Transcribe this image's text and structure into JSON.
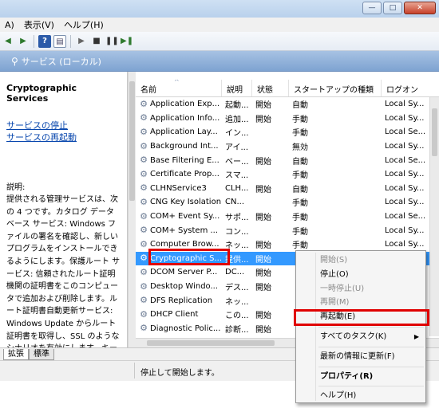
{
  "window": {
    "min": "—",
    "max": "□",
    "close": "✕"
  },
  "menu": {
    "items": [
      "A)",
      "表示(V)",
      "ヘルプ(H)"
    ]
  },
  "toolbar": {
    "icons": [
      "forward-icon",
      "back-icon",
      "help-icon",
      "properties-icon",
      "play-icon",
      "stop-icon",
      "pause-icon",
      "restart-icon"
    ]
  },
  "scope": {
    "title": "サービス (ローカル)",
    "icon": "search-icon"
  },
  "left": {
    "service_name": "Cryptographic Services",
    "link_stop": "サービスの停止",
    "link_restart": "サービスの再起動",
    "desc_label": "説明:",
    "desc_text": "提供される管理サービスは、次の 4 つです。カタログ データベース サービス: Windows ファイルの署名を確認し、新しいプログラムをインストールできるようにします。保護ルート サービス: 信頼されたルート証明機関の証明書をこのコンピュータで追加および削除します。ルート証明書自動更新サービス: Windows Update からルート証明書を取得し、SSL のようなシナリオを有効にします。キー サービス: 証明書用にこのコンピュータを登録します。このサー"
  },
  "columns": {
    "name": "名前",
    "desc": "説明",
    "state": "状態",
    "startup": "スタートアップの種類",
    "logon": "ログオン"
  },
  "services": [
    {
      "name": "Application Exp...",
      "desc": "起動...",
      "state": "開始",
      "startup": "自動",
      "logon": "Local Sy..."
    },
    {
      "name": "Application Info...",
      "desc": "追加...",
      "state": "開始",
      "startup": "手動",
      "logon": "Local Sy..."
    },
    {
      "name": "Application Lay...",
      "desc": "イン...",
      "state": "",
      "startup": "手動",
      "logon": "Local Se..."
    },
    {
      "name": "Background Int...",
      "desc": "アイ...",
      "state": "",
      "startup": "無効",
      "logon": "Local Sy..."
    },
    {
      "name": "Base Filtering E...",
      "desc": "ベー...",
      "state": "開始",
      "startup": "自動",
      "logon": "Local Se..."
    },
    {
      "name": "Certificate Prop...",
      "desc": "スマ...",
      "state": "",
      "startup": "手動",
      "logon": "Local Sy..."
    },
    {
      "name": "CLHNService3",
      "desc": "CLH...",
      "state": "開始",
      "startup": "自動",
      "logon": "Local Sy..."
    },
    {
      "name": "CNG Key Isolation",
      "desc": "CN...",
      "state": "",
      "startup": "手動",
      "logon": "Local Sy..."
    },
    {
      "name": "COM+ Event Sy...",
      "desc": "サポ...",
      "state": "開始",
      "startup": "手動",
      "logon": "Local Se..."
    },
    {
      "name": "COM+ System ...",
      "desc": "コン...",
      "state": "",
      "startup": "手動",
      "logon": "Local Sy..."
    },
    {
      "name": "Computer Brow...",
      "desc": "ネッ...",
      "state": "開始",
      "startup": "手動",
      "logon": "Local Sy..."
    },
    {
      "name": "Cryptographic S...",
      "desc": "提供...",
      "state": "開始",
      "startup": "",
      "logon": ""
    },
    {
      "name": "DCOM Server P...",
      "desc": "DC...",
      "state": "開始",
      "startup": "",
      "logon": ""
    },
    {
      "name": "Desktop Windo...",
      "desc": "デス...",
      "state": "開始",
      "startup": "",
      "logon": ""
    },
    {
      "name": "DFS Replication",
      "desc": "ネッ...",
      "state": "",
      "startup": "",
      "logon": ""
    },
    {
      "name": "DHCP Client",
      "desc": "この...",
      "state": "開始",
      "startup": "",
      "logon": ""
    },
    {
      "name": "Diagnostic Polic...",
      "desc": "診断...",
      "state": "開始",
      "startup": "",
      "logon": ""
    }
  ],
  "tabs": {
    "extended": "拡張",
    "standard": "標準"
  },
  "status": {
    "text": "停止して開始します。"
  },
  "context_menu": {
    "start": "開始(S)",
    "stop": "停止(O)",
    "pause": "一時停止(U)",
    "resume": "再開(M)",
    "restart": "再起動(E)",
    "all_tasks": "すべてのタスク(K)",
    "refresh": "最新の情報に更新(F)",
    "properties": "プロパティ(R)",
    "help": "ヘルプ(H)"
  },
  "colors": {
    "selection": "#3399ff",
    "highlight_box": "#e00000",
    "link": "#0645ad"
  }
}
